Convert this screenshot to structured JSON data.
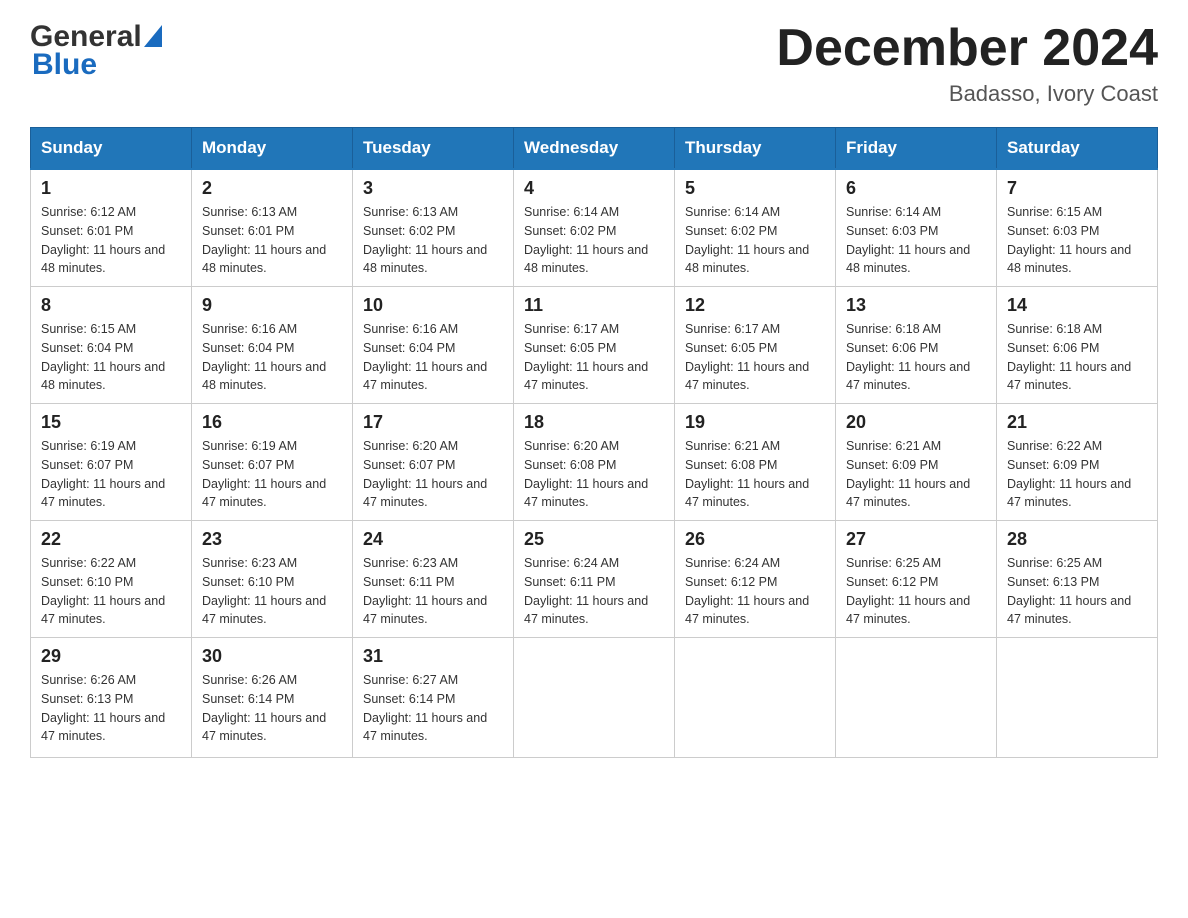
{
  "header": {
    "logo_general": "General",
    "logo_blue": "Blue",
    "month_title": "December 2024",
    "location": "Badasso, Ivory Coast"
  },
  "days_of_week": [
    "Sunday",
    "Monday",
    "Tuesday",
    "Wednesday",
    "Thursday",
    "Friday",
    "Saturday"
  ],
  "weeks": [
    [
      {
        "day": "1",
        "sunrise": "Sunrise: 6:12 AM",
        "sunset": "Sunset: 6:01 PM",
        "daylight": "Daylight: 11 hours and 48 minutes."
      },
      {
        "day": "2",
        "sunrise": "Sunrise: 6:13 AM",
        "sunset": "Sunset: 6:01 PM",
        "daylight": "Daylight: 11 hours and 48 minutes."
      },
      {
        "day": "3",
        "sunrise": "Sunrise: 6:13 AM",
        "sunset": "Sunset: 6:02 PM",
        "daylight": "Daylight: 11 hours and 48 minutes."
      },
      {
        "day": "4",
        "sunrise": "Sunrise: 6:14 AM",
        "sunset": "Sunset: 6:02 PM",
        "daylight": "Daylight: 11 hours and 48 minutes."
      },
      {
        "day": "5",
        "sunrise": "Sunrise: 6:14 AM",
        "sunset": "Sunset: 6:02 PM",
        "daylight": "Daylight: 11 hours and 48 minutes."
      },
      {
        "day": "6",
        "sunrise": "Sunrise: 6:14 AM",
        "sunset": "Sunset: 6:03 PM",
        "daylight": "Daylight: 11 hours and 48 minutes."
      },
      {
        "day": "7",
        "sunrise": "Sunrise: 6:15 AM",
        "sunset": "Sunset: 6:03 PM",
        "daylight": "Daylight: 11 hours and 48 minutes."
      }
    ],
    [
      {
        "day": "8",
        "sunrise": "Sunrise: 6:15 AM",
        "sunset": "Sunset: 6:04 PM",
        "daylight": "Daylight: 11 hours and 48 minutes."
      },
      {
        "day": "9",
        "sunrise": "Sunrise: 6:16 AM",
        "sunset": "Sunset: 6:04 PM",
        "daylight": "Daylight: 11 hours and 48 minutes."
      },
      {
        "day": "10",
        "sunrise": "Sunrise: 6:16 AM",
        "sunset": "Sunset: 6:04 PM",
        "daylight": "Daylight: 11 hours and 47 minutes."
      },
      {
        "day": "11",
        "sunrise": "Sunrise: 6:17 AM",
        "sunset": "Sunset: 6:05 PM",
        "daylight": "Daylight: 11 hours and 47 minutes."
      },
      {
        "day": "12",
        "sunrise": "Sunrise: 6:17 AM",
        "sunset": "Sunset: 6:05 PM",
        "daylight": "Daylight: 11 hours and 47 minutes."
      },
      {
        "day": "13",
        "sunrise": "Sunrise: 6:18 AM",
        "sunset": "Sunset: 6:06 PM",
        "daylight": "Daylight: 11 hours and 47 minutes."
      },
      {
        "day": "14",
        "sunrise": "Sunrise: 6:18 AM",
        "sunset": "Sunset: 6:06 PM",
        "daylight": "Daylight: 11 hours and 47 minutes."
      }
    ],
    [
      {
        "day": "15",
        "sunrise": "Sunrise: 6:19 AM",
        "sunset": "Sunset: 6:07 PM",
        "daylight": "Daylight: 11 hours and 47 minutes."
      },
      {
        "day": "16",
        "sunrise": "Sunrise: 6:19 AM",
        "sunset": "Sunset: 6:07 PM",
        "daylight": "Daylight: 11 hours and 47 minutes."
      },
      {
        "day": "17",
        "sunrise": "Sunrise: 6:20 AM",
        "sunset": "Sunset: 6:07 PM",
        "daylight": "Daylight: 11 hours and 47 minutes."
      },
      {
        "day": "18",
        "sunrise": "Sunrise: 6:20 AM",
        "sunset": "Sunset: 6:08 PM",
        "daylight": "Daylight: 11 hours and 47 minutes."
      },
      {
        "day": "19",
        "sunrise": "Sunrise: 6:21 AM",
        "sunset": "Sunset: 6:08 PM",
        "daylight": "Daylight: 11 hours and 47 minutes."
      },
      {
        "day": "20",
        "sunrise": "Sunrise: 6:21 AM",
        "sunset": "Sunset: 6:09 PM",
        "daylight": "Daylight: 11 hours and 47 minutes."
      },
      {
        "day": "21",
        "sunrise": "Sunrise: 6:22 AM",
        "sunset": "Sunset: 6:09 PM",
        "daylight": "Daylight: 11 hours and 47 minutes."
      }
    ],
    [
      {
        "day": "22",
        "sunrise": "Sunrise: 6:22 AM",
        "sunset": "Sunset: 6:10 PM",
        "daylight": "Daylight: 11 hours and 47 minutes."
      },
      {
        "day": "23",
        "sunrise": "Sunrise: 6:23 AM",
        "sunset": "Sunset: 6:10 PM",
        "daylight": "Daylight: 11 hours and 47 minutes."
      },
      {
        "day": "24",
        "sunrise": "Sunrise: 6:23 AM",
        "sunset": "Sunset: 6:11 PM",
        "daylight": "Daylight: 11 hours and 47 minutes."
      },
      {
        "day": "25",
        "sunrise": "Sunrise: 6:24 AM",
        "sunset": "Sunset: 6:11 PM",
        "daylight": "Daylight: 11 hours and 47 minutes."
      },
      {
        "day": "26",
        "sunrise": "Sunrise: 6:24 AM",
        "sunset": "Sunset: 6:12 PM",
        "daylight": "Daylight: 11 hours and 47 minutes."
      },
      {
        "day": "27",
        "sunrise": "Sunrise: 6:25 AM",
        "sunset": "Sunset: 6:12 PM",
        "daylight": "Daylight: 11 hours and 47 minutes."
      },
      {
        "day": "28",
        "sunrise": "Sunrise: 6:25 AM",
        "sunset": "Sunset: 6:13 PM",
        "daylight": "Daylight: 11 hours and 47 minutes."
      }
    ],
    [
      {
        "day": "29",
        "sunrise": "Sunrise: 6:26 AM",
        "sunset": "Sunset: 6:13 PM",
        "daylight": "Daylight: 11 hours and 47 minutes."
      },
      {
        "day": "30",
        "sunrise": "Sunrise: 6:26 AM",
        "sunset": "Sunset: 6:14 PM",
        "daylight": "Daylight: 11 hours and 47 minutes."
      },
      {
        "day": "31",
        "sunrise": "Sunrise: 6:27 AM",
        "sunset": "Sunset: 6:14 PM",
        "daylight": "Daylight: 11 hours and 47 minutes."
      },
      null,
      null,
      null,
      null
    ]
  ]
}
